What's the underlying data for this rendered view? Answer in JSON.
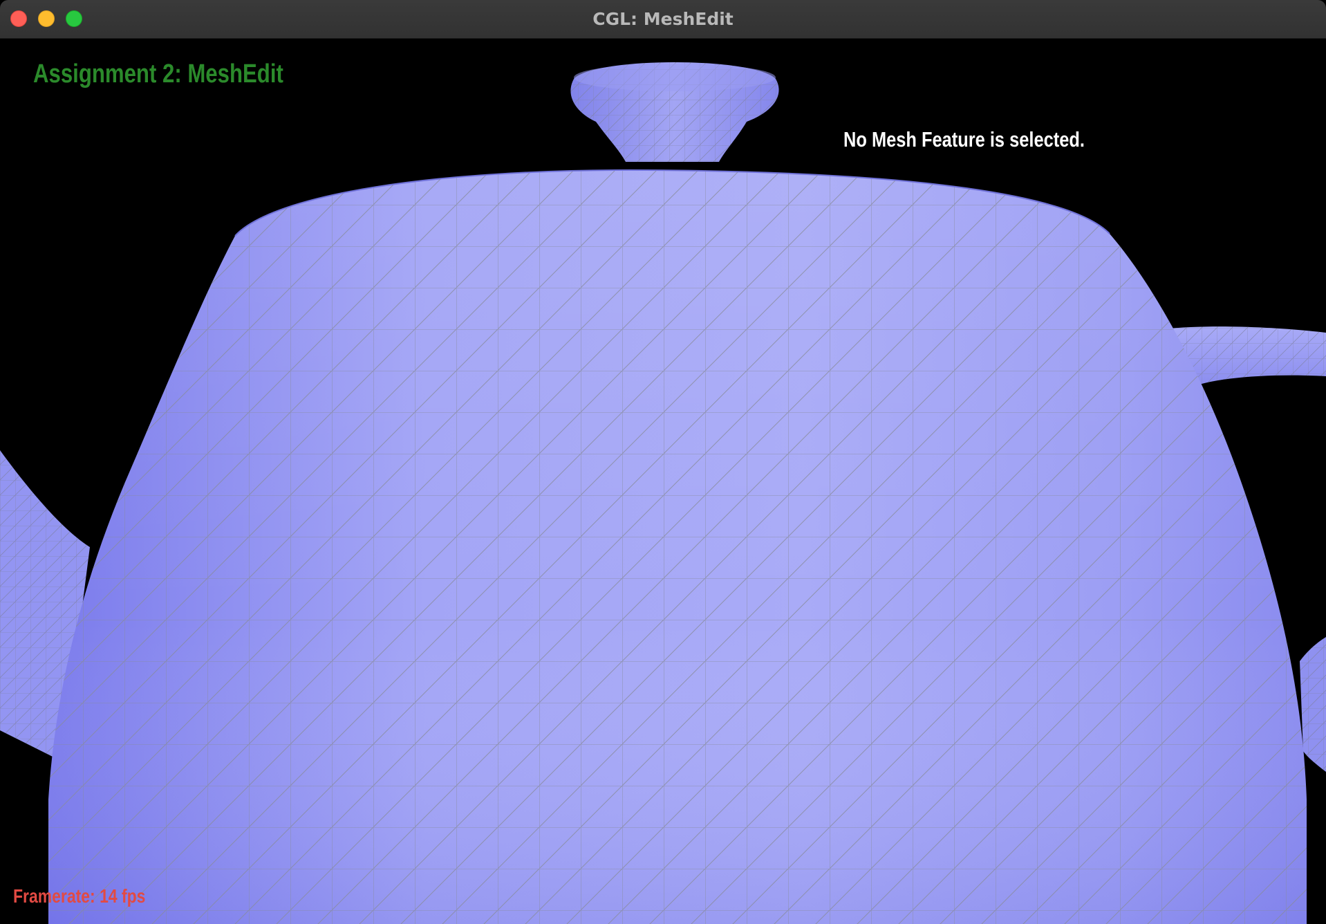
{
  "window": {
    "title": "CGL: MeshEdit",
    "controls": [
      "close",
      "minimize",
      "zoom"
    ]
  },
  "overlay": {
    "heading": "Assignment 2: MeshEdit",
    "selection_status": "No Mesh Feature is selected.",
    "framerate_label": "Framerate:",
    "framerate_value": "14 fps"
  },
  "scene": {
    "model": "teapot",
    "shading": "flat-wireframe",
    "mesh_color": "#a4a6f5",
    "mesh_dark_color": "#8484ec",
    "wire_color": "#8a8a9a",
    "background_color": "#000000"
  },
  "colors": {
    "heading": "#2b8a2b",
    "status_text": "#ffffff",
    "framerate": "#e24a43"
  }
}
